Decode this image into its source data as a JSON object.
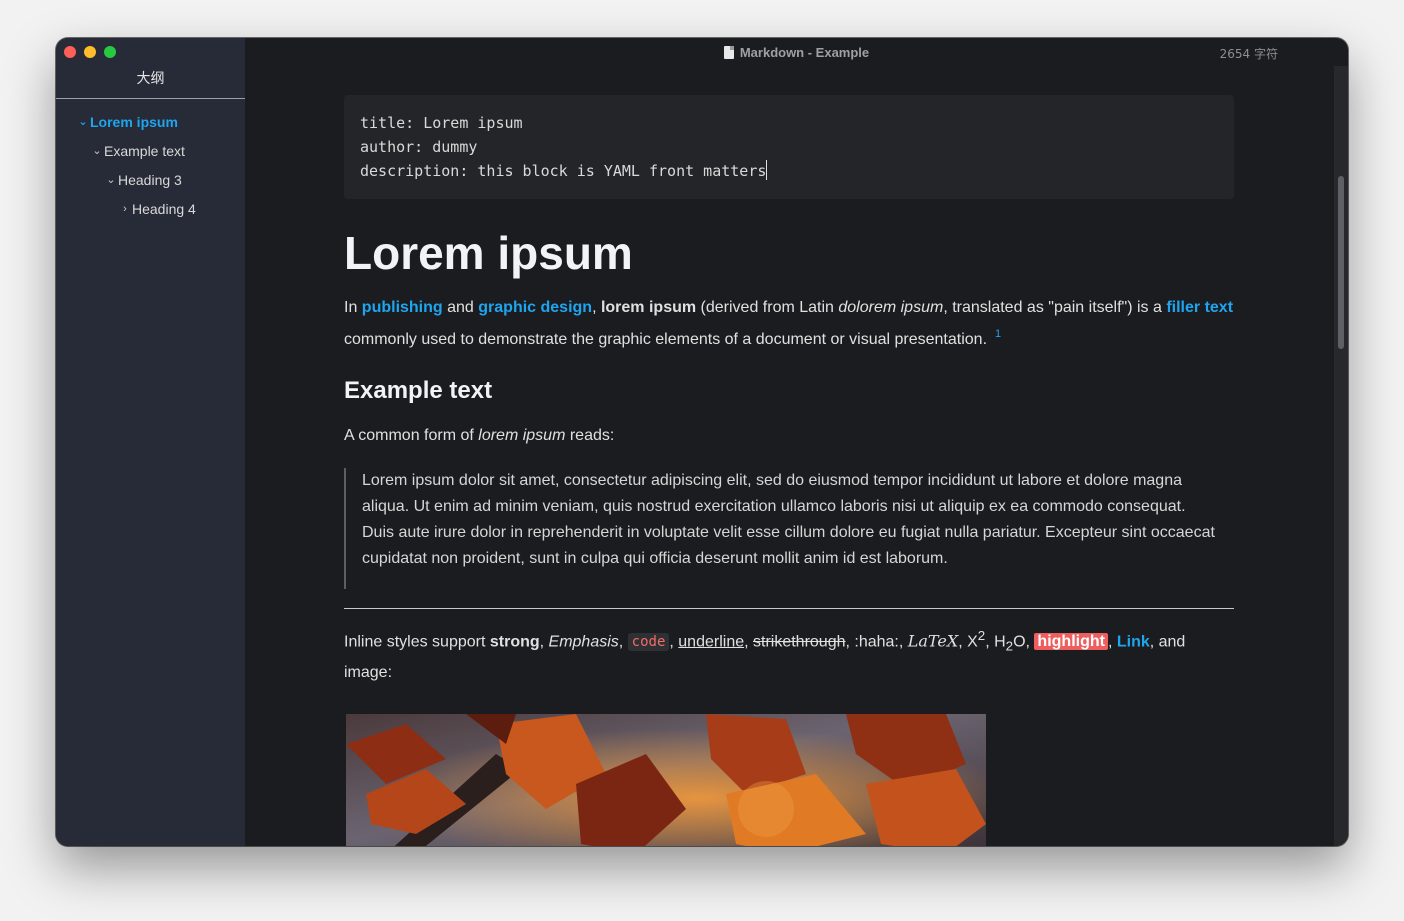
{
  "window": {
    "title": "Markdown - Example",
    "word_count": "2654 字符"
  },
  "sidebar": {
    "title": "大纲",
    "items": [
      {
        "label": "Lorem ipsum",
        "chevron": "⌄"
      },
      {
        "label": "Example text",
        "chevron": "⌄"
      },
      {
        "label": "Heading 3",
        "chevron": "⌄"
      },
      {
        "label": "Heading 4",
        "chevron": "›"
      }
    ]
  },
  "yaml": {
    "line1": "title: Lorem ipsum",
    "line2": "author: dummy",
    "line3": "description: this block is YAML front matters"
  },
  "doc": {
    "h1": "Lorem ipsum",
    "intro": {
      "t1": "In ",
      "link1": "publishing",
      "t2": " and ",
      "link2": "graphic design",
      "t3": ", ",
      "bold1": "lorem ipsum",
      "t4": " (derived from Latin ",
      "em1": "dolorem ipsum",
      "t5": ", translated as \"pain itself\") is a ",
      "link3": "filler text",
      "t6": " commonly used to demonstrate the graphic elements of a document or visual presentation.",
      "footnote": "1"
    },
    "h2": "Example text",
    "common": {
      "t1": "A common form of ",
      "em": "lorem ipsum",
      "t2": " reads:"
    },
    "quote": "Lorem ipsum dolor sit amet, consectetur adipiscing elit, sed do eiusmod tempor incididunt ut labore et dolore magna aliqua. Ut enim ad minim veniam, quis nostrud exercitation ullamco laboris nisi ut aliquip ex ea commodo consequat. Duis aute irure dolor in reprehenderit in voluptate velit esse cillum dolore eu fugiat nulla pariatur. Excepteur sint occaecat cupidatat non proident, sunt in culpa qui officia deserunt mollit anim id est laborum.",
    "inline": {
      "lead": "Inline styles support ",
      "strong": "strong",
      "sep1": ", ",
      "emphasis": "Emphasis",
      "sep2": ", ",
      "code": "code",
      "sep3": ", ",
      "underline": "underline",
      "sep4": ", ",
      "strike": "strikethrough",
      "haha": ", :haha:, ",
      "latex": "LaTeX",
      "sep5": ", X",
      "sup": "2",
      "h2o_a": ", H",
      "sub": "2",
      "h2o_b": "O, ",
      "highlight": "highlight",
      "sep6": ", ",
      "link": "Link",
      "tail": ", and image:"
    }
  },
  "colors": {
    "link": "#1ea5ef",
    "highlight": "#ef5e5e",
    "sidebar_bg": "#272b37",
    "editor_bg": "#1b1c1f"
  }
}
